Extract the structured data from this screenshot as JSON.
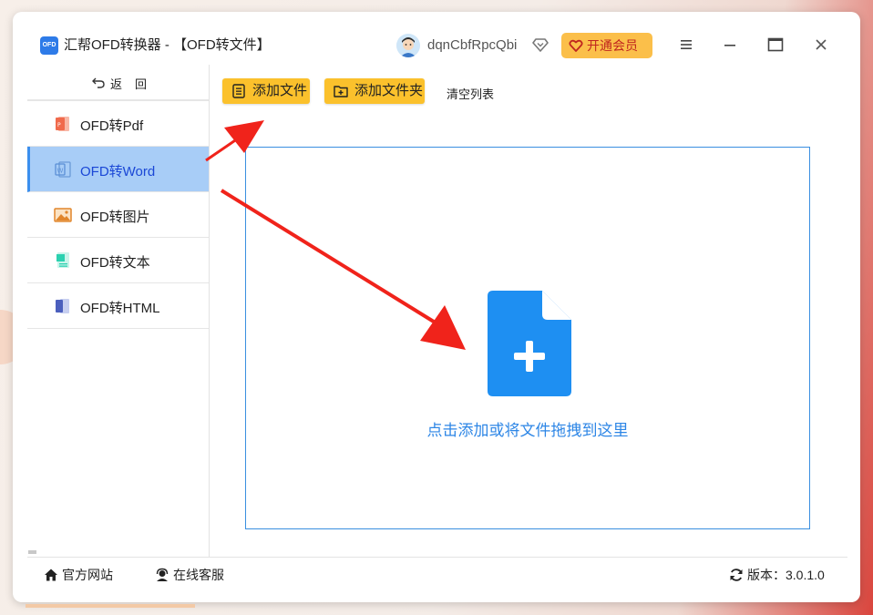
{
  "window": {
    "logo_text": "OFD",
    "title": "汇帮OFD转换器 - 【OFD转文件】",
    "username": "dqnCbfRpcQbi",
    "vip_label": "开通会员"
  },
  "sidebar": {
    "back_label": "返回",
    "items": [
      {
        "label": "OFD转Pdf",
        "icon": "pdf-icon",
        "color": "#f06a4c"
      },
      {
        "label": "OFD转Word",
        "icon": "word-icon",
        "color": "#5a8fd6",
        "active": true
      },
      {
        "label": "OFD转图片",
        "icon": "image-icon",
        "color": "#e1862b"
      },
      {
        "label": "OFD转文本",
        "icon": "text-icon",
        "color": "#2bd1b0"
      },
      {
        "label": "OFD转HTML",
        "icon": "html-icon",
        "color": "#4b5fbd"
      }
    ]
  },
  "toolbar": {
    "add_file_label": "添加文件",
    "add_folder_label": "添加文件夹",
    "clear_label": "清空列表"
  },
  "dropzone": {
    "hint": "点击添加或将文件拖拽到这里"
  },
  "footer": {
    "website_label": "官方网站",
    "support_label": "在线客服",
    "version_label": "版本：3.0.1.0"
  },
  "colors": {
    "accent": "#2d86e6",
    "button_yellow": "#fbc12c",
    "active_nav": "#a8cdf7",
    "arrow_red": "#f0231b"
  }
}
